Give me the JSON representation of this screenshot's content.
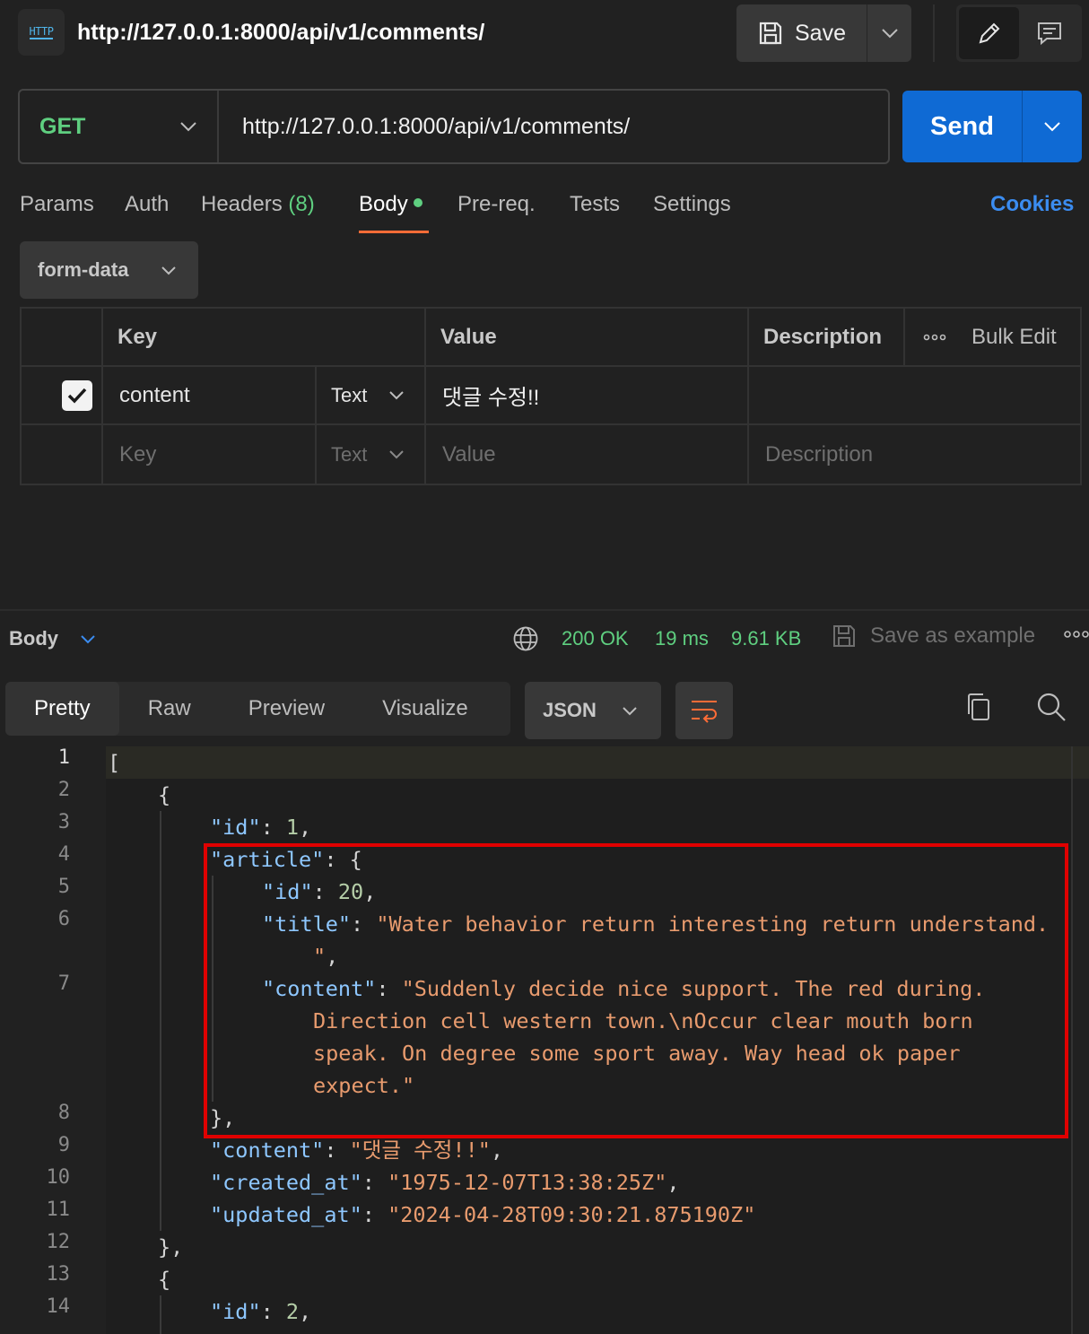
{
  "header": {
    "badge": "HTTP",
    "title": "http://127.0.0.1:8000/api/v1/comments/",
    "save_label": "Save"
  },
  "request": {
    "method": "GET",
    "url": "http://127.0.0.1:8000/api/v1/comments/",
    "send_label": "Send"
  },
  "tabs": {
    "params": "Params",
    "auth": "Auth",
    "headers": "Headers",
    "headers_count": "(8)",
    "body": "Body",
    "prereq": "Pre-req.",
    "tests": "Tests",
    "settings": "Settings",
    "cookies": "Cookies"
  },
  "body_type": "form-data",
  "table": {
    "headers": {
      "key": "Key",
      "value": "Value",
      "description": "Description",
      "bulk_edit": "Bulk Edit"
    },
    "rows": [
      {
        "checked": true,
        "key": "content",
        "type": "Text",
        "value": "댓글 수정!!",
        "description": ""
      }
    ],
    "placeholder": {
      "key": "Key",
      "type": "Text",
      "value": "Value",
      "description": "Description"
    }
  },
  "response": {
    "section_label": "Body",
    "status": "200 OK",
    "time": "19 ms",
    "size": "9.61 KB",
    "save_example": "Save as example",
    "view_tabs": [
      "Pretty",
      "Raw",
      "Preview",
      "Visualize"
    ],
    "active_view": "Pretty",
    "format": "JSON"
  },
  "code": {
    "line_numbers": [
      "1",
      "2",
      "3",
      "4",
      "5",
      "6",
      "7",
      "8",
      "9",
      "10",
      "11",
      "12",
      "13",
      "14"
    ],
    "l1": "[",
    "l2": "{",
    "l3_key": "\"id\"",
    "l3_val": "1",
    "l4_key": "\"article\"",
    "l5_key": "\"id\"",
    "l5_val": "20",
    "l6_key": "\"title\"",
    "l6_val_a": "\"Water behavior return interesting return understand.",
    "l6_val_b": "\"",
    "l7_key": "\"content\"",
    "l7_val_a": "\"Suddenly decide nice support. The red during.",
    "l7_val_b": "Direction cell western town.\\nOccur clear mouth born",
    "l7_val_c": "speak. On degree some sport away. Way head ok paper",
    "l7_val_d": "expect.\"",
    "l9_key": "\"content\"",
    "l9_val": "\"댓글 수정!!\"",
    "l10_key": "\"created_at\"",
    "l10_val": "\"1975-12-07T13:38:25Z\"",
    "l11_key": "\"updated_at\"",
    "l11_val": "\"2024-04-28T09:30:21.875190Z\"",
    "l14_key": "\"id\"",
    "l14_val": "2"
  },
  "colors": {
    "accent": "#0f6ad4",
    "success": "#5fcf80",
    "active_tab": "#ff6c37",
    "highlight_box": "#e00000"
  }
}
